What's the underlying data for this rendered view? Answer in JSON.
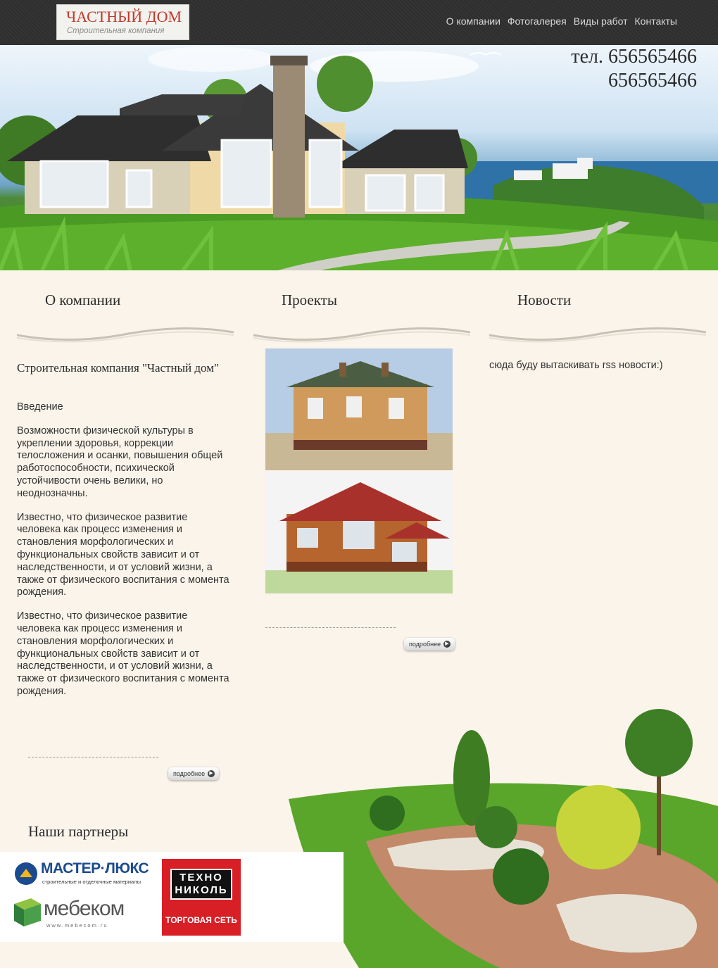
{
  "header": {
    "logo_title": "ЧАСТНЫЙ ДОМ",
    "logo_subtitle": "Строительная компания",
    "nav": [
      "О компании",
      "Фотогалерея",
      "Виды работ",
      "Контакты"
    ]
  },
  "hero": {
    "phone_line1": "тел. 656565466",
    "phone_line2": "656565466"
  },
  "columns": {
    "about": {
      "title": "О компании",
      "heading": "Строительная компания \"Частный дом\"",
      "paragraphs": [
        "Введение",
        "Возможности физической культуры в укреплении здоровья, коррекции телосложения и осанки, повышения общей работоспособности, психической устойчивости очень велики, но неоднозначны.",
        "Известно, что физическое развитие человека как процесс изменения и становления морфологических и функциональных свойств зависит и от наследственности, и от условий жизни, а также от физического воспитания с момента рождения.",
        "Известно, что физическое развитие человека как процесс изменения и становления морфологических и функциональных свойств зависит и от наследственности, и от условий жизни, а также от физического воспитания с момента рождения."
      ],
      "more": "подробнее"
    },
    "projects": {
      "title": "Проекты",
      "more": "подробнее"
    },
    "news": {
      "title": "Новости",
      "text": "сюда буду вытаскивать rss новости:)"
    }
  },
  "partners": {
    "title": "Наши партнеры",
    "logos": [
      {
        "name": "МАСТЕР·ЛЮКС",
        "tagline": "строительные и отделочные материалы"
      },
      {
        "name": "ТЕХНО НИКОЛЬ",
        "tagline": "ТОРГОВАЯ СЕТЬ"
      },
      {
        "name": "мебеком",
        "tagline": "www.mebecom.ru"
      }
    ]
  },
  "colors": {
    "header_bg": "#2e2e2e",
    "page_bg": "#faf4ea",
    "logo_red": "#c0392b",
    "tekhno_red": "#d81f26"
  }
}
